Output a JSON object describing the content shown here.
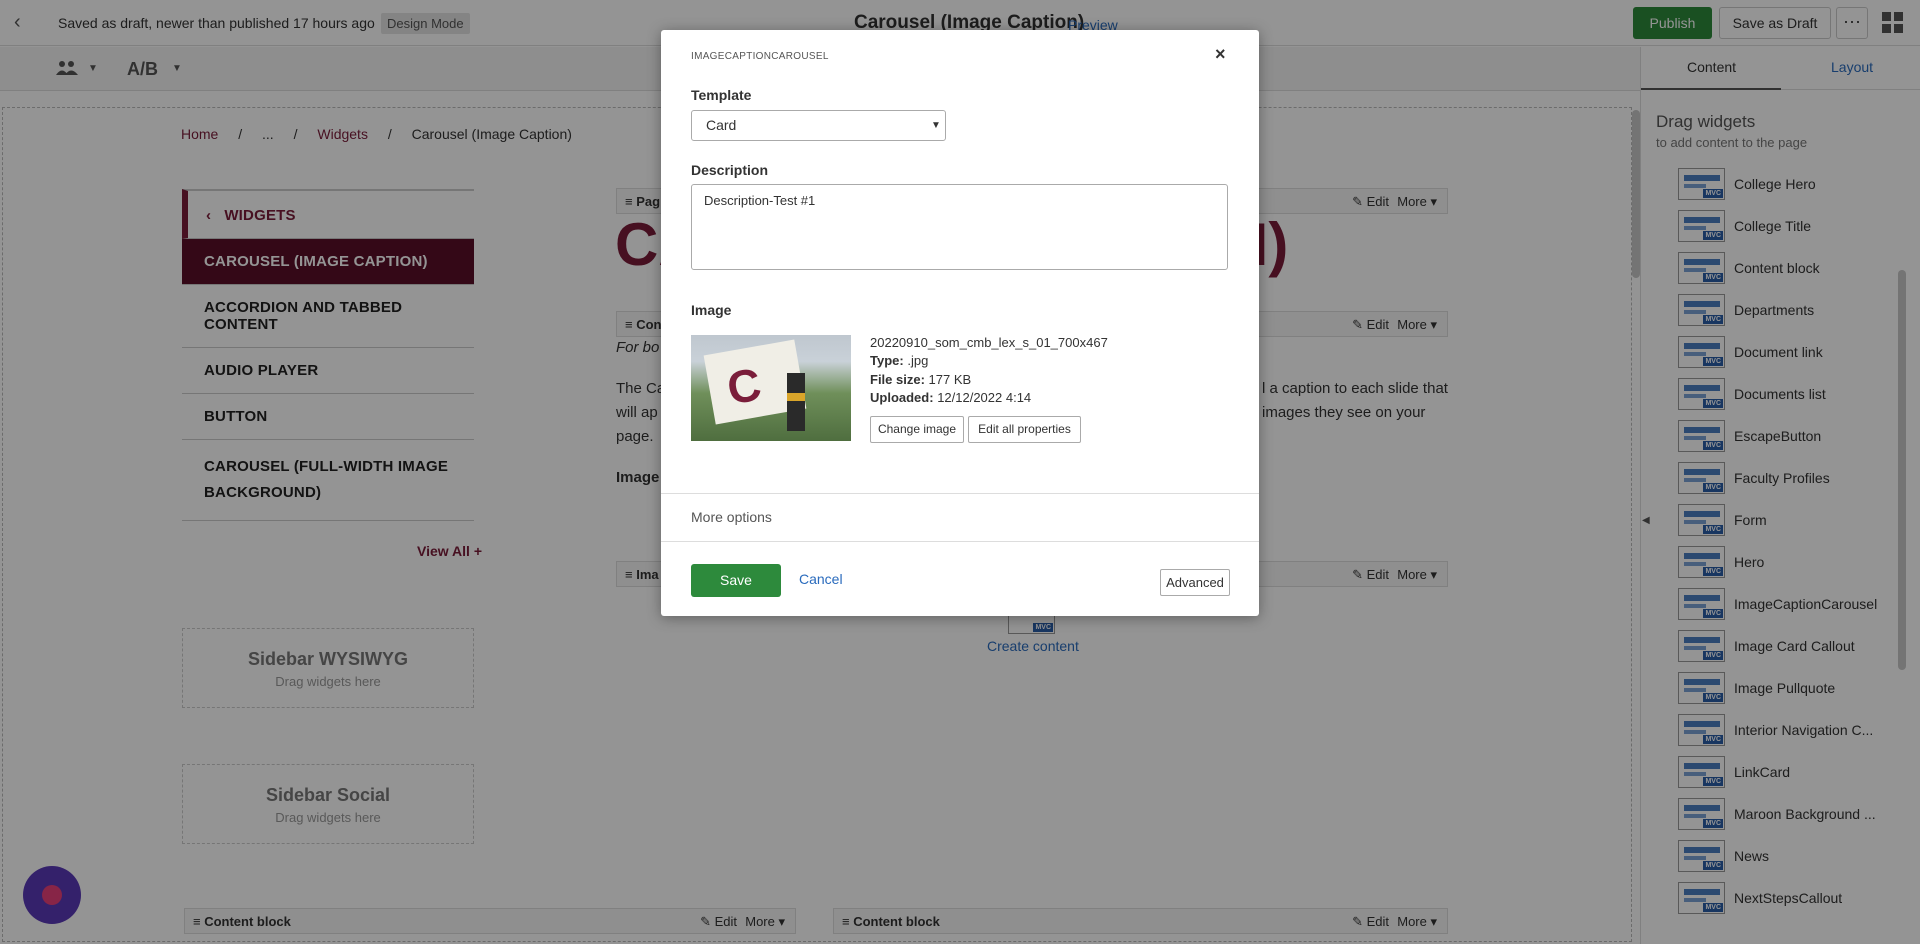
{
  "topbar": {
    "draft_status": "Saved as draft, newer than published 17 hours ago",
    "mode_badge": "Design Mode",
    "page_title": "Carousel (Image Caption)",
    "preview_label": "Preview",
    "publish_label": "Publish",
    "save_draft_label": "Save as Draft",
    "more_label": "···"
  },
  "toolbar": {
    "ab_label": "A/B"
  },
  "breadcrumb": {
    "home": "Home",
    "ellipsis": "...",
    "widgets": "Widgets",
    "current": "Carousel (Image Caption)",
    "separator": "/"
  },
  "sidebar_nav": {
    "header": "WIDGETS",
    "items": [
      "CAROUSEL (IMAGE CAPTION)",
      "ACCORDION AND TABBED CONTENT",
      "AUDIO PLAYER",
      "BUTTON",
      "CAROUSEL (FULL-WIDTH IMAGE BACKGROUND)"
    ],
    "view_all": "View All"
  },
  "drop_zones": [
    {
      "title": "Sidebar WYSIWYG",
      "sub": "Drag widgets here"
    },
    {
      "title": "Sidebar Social",
      "sub": "Drag widgets here"
    }
  ],
  "canvas": {
    "heading_left": "CA",
    "heading_right": "N)",
    "page_widget_label": "Pag",
    "content_widget_label": "Con",
    "image_widget_label": "Ima",
    "for_bo": "For bo",
    "para_line1_left": "The Ca",
    "para_line2_left": "will ap",
    "para_line3_left": "page.",
    "para_line1_right": "l a caption to each slide that",
    "para_line2_right": "images they see on your",
    "image_bold": "Image",
    "edit_label": "Edit",
    "more_label": "More",
    "create_content": "Create content",
    "bottom_widgets": [
      "Content block",
      "Content block"
    ]
  },
  "right_panel": {
    "tab_content": "Content",
    "tab_layout": "Layout",
    "drag_title": "Drag widgets",
    "drag_sub": "to add content to the page",
    "mvc_badge": "MVC",
    "widgets": [
      "College Hero",
      "College Title",
      "Content block",
      "Departments",
      "Document link",
      "Documents list",
      "EscapeButton",
      "Faculty Profiles",
      "Form",
      "Hero",
      "ImageCaptionCarousel",
      "Image Card Callout",
      "Image Pullquote",
      "Interior Navigation C...",
      "LinkCard",
      "Maroon Background ...",
      "News",
      "NextStepsCallout"
    ]
  },
  "modal": {
    "kicker": "IMAGECAPTIONCAROUSEL",
    "close_label": "×",
    "template_label": "Template",
    "template_value": "Card",
    "description_label": "Description",
    "description_value": "Description-Test #1",
    "image_label": "Image",
    "file_name": "20220910_som_cmb_lex_s_01_700x467",
    "type_label": "Type:",
    "type_value": ".jpg",
    "size_label": "File size:",
    "size_value": "177 KB",
    "uploaded_label": "Uploaded:",
    "uploaded_value": "12/12/2022 4:14",
    "change_image": "Change image",
    "edit_props": "Edit all properties",
    "more_options": "More options",
    "save": "Save",
    "cancel": "Cancel",
    "advanced": "Advanced"
  }
}
